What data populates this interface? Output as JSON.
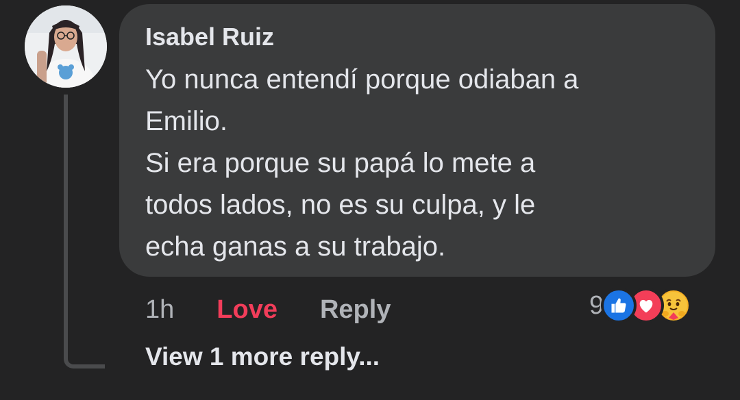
{
  "comment": {
    "author": "Isabel Ruiz",
    "lines": [
      "Yo nunca entendí porque odiaban a",
      "Emilio.",
      "Si era porque su papá lo mete a",
      "todos lados, no es su culpa, y le",
      "echa ganas a su trabajo."
    ],
    "time": "1h",
    "love_label": "Love",
    "reply_label": "Reply",
    "reaction_count": "9",
    "reaction_icons": [
      "like-icon",
      "love-icon",
      "care-icon"
    ]
  },
  "thread": {
    "view_more_label": "View 1 more reply..."
  },
  "colors": {
    "background": "#232324",
    "bubble": "#3a3b3c",
    "love_accent": "#f23d5a",
    "like_blue": "#1b74e4"
  }
}
